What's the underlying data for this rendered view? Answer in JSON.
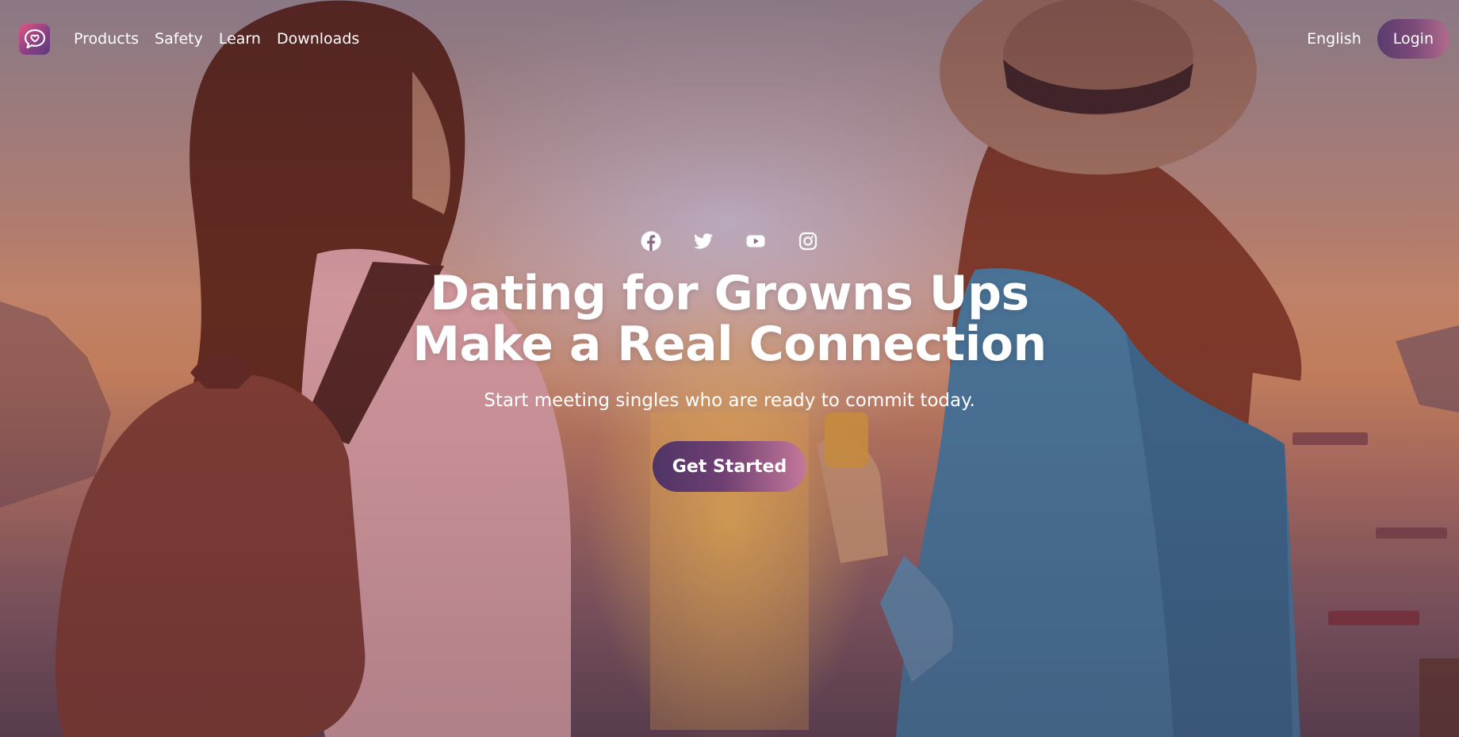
{
  "nav": {
    "logo_icon": "chat-heart-icon",
    "links": [
      {
        "label": "Products"
      },
      {
        "label": "Safety"
      },
      {
        "label": "Learn"
      },
      {
        "label": "Downloads"
      }
    ],
    "language": "English",
    "login_label": "Login"
  },
  "hero": {
    "socials": [
      "facebook-icon",
      "twitter-icon",
      "youtube-icon",
      "instagram-icon"
    ],
    "headline_line1": "Dating for Growns Ups",
    "headline_line2": "Make a Real Connection",
    "subheadline": "Start meeting singles who are ready to commit today.",
    "cta_label": "Get Started"
  },
  "colors": {
    "accent_start": "#4f3466",
    "accent_end": "#c4789a",
    "logo_pink": "#e05683",
    "text": "#ffffff"
  }
}
